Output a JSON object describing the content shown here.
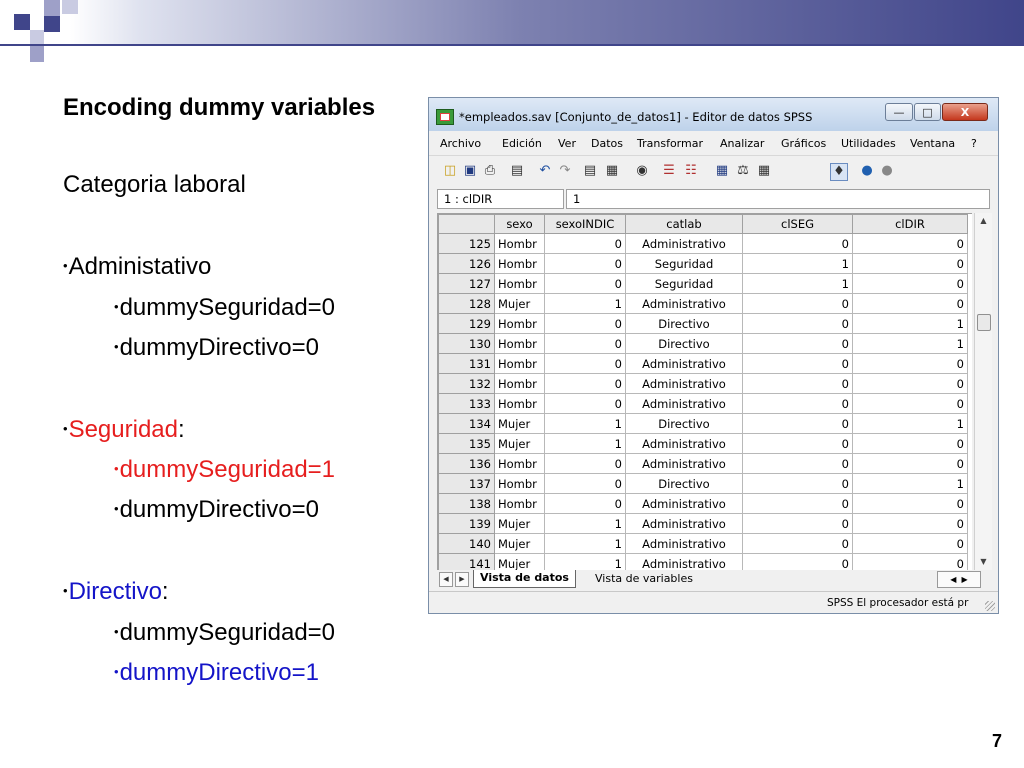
{
  "slide": {
    "title": "Encoding dummy variables",
    "subtitle": "Categoria laboral",
    "page_number": "7",
    "groups": [
      {
        "label": "Administativo",
        "suffix": "",
        "color": "#000000",
        "items": [
          {
            "text": "dummySeguridad=0",
            "color": "#000000"
          },
          {
            "text": "dummyDirectivo=0",
            "color": "#000000"
          }
        ]
      },
      {
        "label": "Seguridad",
        "suffix": ":",
        "color": "#e61e1e",
        "items": [
          {
            "text": "dummySeguridad=1",
            "color": "#e61e1e"
          },
          {
            "text": "dummyDirectivo=0",
            "color": "#000000"
          }
        ]
      },
      {
        "label": "Directivo",
        "suffix": ":",
        "color": "#1414c8",
        "items": [
          {
            "text": "dummySeguridad=0",
            "color": "#000000"
          },
          {
            "text": "dummyDirectivo=1",
            "color": "#1414c8"
          }
        ]
      }
    ]
  },
  "spss_window": {
    "title": "*empleados.sav [Conjunto_de_datos1] - Editor de datos SPSS",
    "window_buttons": {
      "minimize": "—",
      "maximize": "□",
      "close": "X"
    },
    "menu": [
      "Archivo",
      "Edición",
      "Ver",
      "Datos",
      "Transformar",
      "Analizar",
      "Gráficos",
      "Utilidades",
      "Ventana",
      "?"
    ],
    "toolbar_icons": [
      "open-folder-icon",
      "save-icon",
      "print-icon",
      "dialog-recall-icon",
      "undo-icon",
      "redo-icon",
      "goto-case-icon",
      "variables-icon",
      "find-icon",
      "insert-cases-icon",
      "insert-variable-icon",
      "split-file-icon",
      "weight-cases-icon",
      "select-cases-icon",
      "value-labels-icon",
      "use-sets-icon",
      "show-all-icon"
    ],
    "cell_reference": "1 : clDIR",
    "cell_value": "1",
    "columns": [
      "sexo",
      "sexoINDIC",
      "catlab",
      "clSEG",
      "clDIR"
    ],
    "rows": [
      {
        "n": "125",
        "sexo": "Hombr",
        "sexoINDIC": "0",
        "catlab": "Administrativo",
        "clSEG": "0",
        "clDIR": "0"
      },
      {
        "n": "126",
        "sexo": "Hombr",
        "sexoINDIC": "0",
        "catlab": "Seguridad",
        "clSEG": "1",
        "clDIR": "0"
      },
      {
        "n": "127",
        "sexo": "Hombr",
        "sexoINDIC": "0",
        "catlab": "Seguridad",
        "clSEG": "1",
        "clDIR": "0"
      },
      {
        "n": "128",
        "sexo": "Mujer",
        "sexoINDIC": "1",
        "catlab": "Administrativo",
        "clSEG": "0",
        "clDIR": "0"
      },
      {
        "n": "129",
        "sexo": "Hombr",
        "sexoINDIC": "0",
        "catlab": "Directivo",
        "clSEG": "0",
        "clDIR": "1"
      },
      {
        "n": "130",
        "sexo": "Hombr",
        "sexoINDIC": "0",
        "catlab": "Directivo",
        "clSEG": "0",
        "clDIR": "1"
      },
      {
        "n": "131",
        "sexo": "Hombr",
        "sexoINDIC": "0",
        "catlab": "Administrativo",
        "clSEG": "0",
        "clDIR": "0"
      },
      {
        "n": "132",
        "sexo": "Hombr",
        "sexoINDIC": "0",
        "catlab": "Administrativo",
        "clSEG": "0",
        "clDIR": "0"
      },
      {
        "n": "133",
        "sexo": "Hombr",
        "sexoINDIC": "0",
        "catlab": "Administrativo",
        "clSEG": "0",
        "clDIR": "0"
      },
      {
        "n": "134",
        "sexo": "Mujer",
        "sexoINDIC": "1",
        "catlab": "Directivo",
        "clSEG": "0",
        "clDIR": "1"
      },
      {
        "n": "135",
        "sexo": "Mujer",
        "sexoINDIC": "1",
        "catlab": "Administrativo",
        "clSEG": "0",
        "clDIR": "0"
      },
      {
        "n": "136",
        "sexo": "Hombr",
        "sexoINDIC": "0",
        "catlab": "Administrativo",
        "clSEG": "0",
        "clDIR": "0"
      },
      {
        "n": "137",
        "sexo": "Hombr",
        "sexoINDIC": "0",
        "catlab": "Directivo",
        "clSEG": "0",
        "clDIR": "1"
      },
      {
        "n": "138",
        "sexo": "Hombr",
        "sexoINDIC": "0",
        "catlab": "Administrativo",
        "clSEG": "0",
        "clDIR": "0"
      },
      {
        "n": "139",
        "sexo": "Mujer",
        "sexoINDIC": "1",
        "catlab": "Administrativo",
        "clSEG": "0",
        "clDIR": "0"
      },
      {
        "n": "140",
        "sexo": "Mujer",
        "sexoINDIC": "1",
        "catlab": "Administrativo",
        "clSEG": "0",
        "clDIR": "0"
      },
      {
        "n": "141",
        "sexo": "Mujer",
        "sexoINDIC": "1",
        "catlab": "Administrativo",
        "clSEG": "0",
        "clDIR": "0"
      }
    ],
    "tabs": {
      "active": "Vista de datos",
      "inactive": "Vista de variables"
    },
    "status": "SPSS El procesador  está pr"
  },
  "theme": {
    "header_dark": "#40458a",
    "header_light": "#9ea0c8"
  }
}
